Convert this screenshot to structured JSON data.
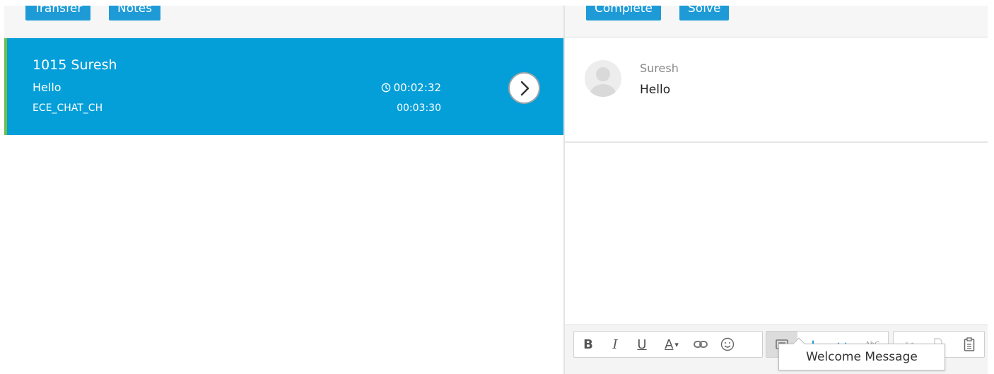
{
  "left_toolbar": {
    "transfer_label": "Transfer",
    "notes_label": "Notes"
  },
  "right_toolbar": {
    "complete_label": "Complete",
    "solve_label": "Solve"
  },
  "conversation": {
    "title": "1015  Suresh",
    "message": "Hello",
    "channel": "ECE_CHAT_CH",
    "wait_time": "00:02:32",
    "total_time": "00:03:30",
    "accent_color": "#049fd9",
    "status_color": "#6cc04a"
  },
  "message_pane": {
    "sender": "Suresh",
    "text": "Hello"
  },
  "editor": {
    "tools": [
      "bold-icon",
      "italic-icon",
      "underline-icon",
      "font-color-icon",
      "link-icon",
      "emoji-icon",
      "template-icon",
      "add-icon",
      "code-icon",
      "spellcheck-icon",
      "cut-icon",
      "copy-icon",
      "paste-icon"
    ],
    "tooltip": "Welcome Message"
  }
}
